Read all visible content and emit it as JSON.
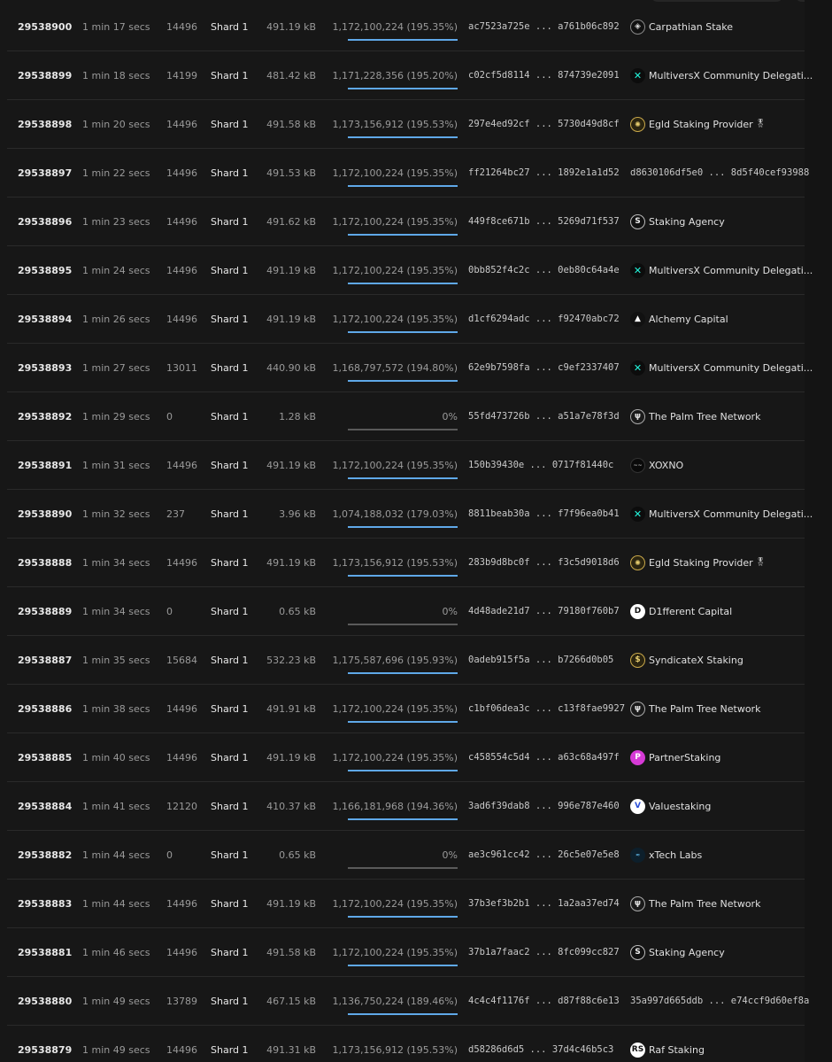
{
  "blocks": [
    {
      "block": "29538900",
      "age": "1 min 17 secs",
      "txs": "14496",
      "shard": "Shard 1",
      "size": "491.19 kB",
      "gas": "1,172,100,224 (195.35%)",
      "gas_pct": 100,
      "hash_start": "ac7523a725e",
      "hash_end": "a761b06c892",
      "validator": "Carpathian Stake",
      "validator_icon": "carpathian-icon",
      "icon_class": "ic-carpathian",
      "badge": ""
    },
    {
      "block": "29538899",
      "age": "1 min 18 secs",
      "txs": "14199",
      "shard": "Shard 1",
      "size": "481.42 kB",
      "gas": "1,171,228,356 (195.20%)",
      "gas_pct": 100,
      "hash_start": "c02cf5d8114",
      "hash_end": "874739e2091",
      "validator": "MultiversX Community Delegati...",
      "validator_icon": "multiversx-icon",
      "icon_class": "ic-mvx",
      "badge": ""
    },
    {
      "block": "29538898",
      "age": "1 min 20 secs",
      "txs": "14496",
      "shard": "Shard 1",
      "size": "491.58 kB",
      "gas": "1,173,156,912 (195.53%)",
      "gas_pct": 100,
      "hash_start": "297e4ed92cf",
      "hash_end": "5730d49d8cf",
      "validator": "Egld Staking Provider",
      "validator_icon": "egld-staking-icon",
      "icon_class": "ic-egld",
      "badge": "🎖"
    },
    {
      "block": "29538897",
      "age": "1 min 22 secs",
      "txs": "14496",
      "shard": "Shard 1",
      "size": "491.53 kB",
      "gas": "1,172,100,224 (195.35%)",
      "gas_pct": 100,
      "hash_start": "ff21264bc27",
      "hash_end": "1892e1a1d52",
      "validator": "d8630106df5e0 ... 8d5f40cef93988",
      "validator_icon": "",
      "icon_class": "",
      "badge": "",
      "plain": true
    },
    {
      "block": "29538896",
      "age": "1 min 23 secs",
      "txs": "14496",
      "shard": "Shard 1",
      "size": "491.62 kB",
      "gas": "1,172,100,224 (195.35%)",
      "gas_pct": 100,
      "hash_start": "449f8ce671b",
      "hash_end": "5269d71f537",
      "validator": "Staking Agency",
      "validator_icon": "staking-agency-icon",
      "icon_class": "ic-staking-agency",
      "badge": ""
    },
    {
      "block": "29538895",
      "age": "1 min 24 secs",
      "txs": "14496",
      "shard": "Shard 1",
      "size": "491.19 kB",
      "gas": "1,172,100,224 (195.35%)",
      "gas_pct": 100,
      "hash_start": "0bb852f4c2c",
      "hash_end": "0eb80c64a4e",
      "validator": "MultiversX Community Delegati...",
      "validator_icon": "multiversx-icon",
      "icon_class": "ic-mvx",
      "badge": ""
    },
    {
      "block": "29538894",
      "age": "1 min 26 secs",
      "txs": "14496",
      "shard": "Shard 1",
      "size": "491.19 kB",
      "gas": "1,172,100,224 (195.35%)",
      "gas_pct": 100,
      "hash_start": "d1cf6294adc",
      "hash_end": "f92470abc72",
      "validator": "Alchemy Capital",
      "validator_icon": "alchemy-icon",
      "icon_class": "ic-alchemy",
      "badge": ""
    },
    {
      "block": "29538893",
      "age": "1 min 27 secs",
      "txs": "13011",
      "shard": "Shard 1",
      "size": "440.90 kB",
      "gas": "1,168,797,572 (194.80%)",
      "gas_pct": 100,
      "hash_start": "62e9b7598fa",
      "hash_end": "c9ef2337407",
      "validator": "MultiversX Community Delegati...",
      "validator_icon": "multiversx-icon",
      "icon_class": "ic-mvx",
      "badge": ""
    },
    {
      "block": "29538892",
      "age": "1 min 29 secs",
      "txs": "0",
      "shard": "Shard 1",
      "size": "1.28 kB",
      "gas": "0%",
      "gas_pct": 0,
      "hash_start": "55fd473726b",
      "hash_end": "a51a7e78f3d",
      "validator": "The Palm Tree Network",
      "validator_icon": "palm-tree-icon",
      "icon_class": "ic-palm",
      "badge": ""
    },
    {
      "block": "29538891",
      "age": "1 min 31 secs",
      "txs": "14496",
      "shard": "Shard 1",
      "size": "491.19 kB",
      "gas": "1,172,100,224 (195.35%)",
      "gas_pct": 100,
      "hash_start": "150b39430e",
      "hash_end": "0717f81440c",
      "validator": "XOXNO",
      "validator_icon": "xoxno-icon",
      "icon_class": "ic-xoxno",
      "badge": ""
    },
    {
      "block": "29538890",
      "age": "1 min 32 secs",
      "txs": "237",
      "shard": "Shard 1",
      "size": "3.96 kB",
      "gas": "1,074,188,032 (179.03%)",
      "gas_pct": 100,
      "hash_start": "8811beab30a",
      "hash_end": "f7f96ea0b41",
      "validator": "MultiversX Community Delegati...",
      "validator_icon": "multiversx-icon",
      "icon_class": "ic-mvx",
      "badge": ""
    },
    {
      "block": "29538888",
      "age": "1 min 34 secs",
      "txs": "14496",
      "shard": "Shard 1",
      "size": "491.19 kB",
      "gas": "1,173,156,912 (195.53%)",
      "gas_pct": 100,
      "hash_start": "283b9d8bc0f",
      "hash_end": "f3c5d9018d6",
      "validator": "Egld Staking Provider",
      "validator_icon": "egld-staking-icon",
      "icon_class": "ic-egld",
      "badge": "🎖"
    },
    {
      "block": "29538889",
      "age": "1 min 34 secs",
      "txs": "0",
      "shard": "Shard 1",
      "size": "0.65 kB",
      "gas": "0%",
      "gas_pct": 0,
      "hash_start": "4d48ade21d7",
      "hash_end": "79180f760b7",
      "validator": "D1fferent Capital",
      "validator_icon": "d1fferent-icon",
      "icon_class": "ic-d1fferent",
      "badge": ""
    },
    {
      "block": "29538887",
      "age": "1 min 35 secs",
      "txs": "15684",
      "shard": "Shard 1",
      "size": "532.23 kB",
      "gas": "1,175,587,696 (195.93%)",
      "gas_pct": 100,
      "hash_start": "0adeb915f5a",
      "hash_end": "b7266d0b05",
      "validator": "SyndicateX Staking",
      "validator_icon": "syndicatex-icon",
      "icon_class": "ic-syndicate",
      "badge": ""
    },
    {
      "block": "29538886",
      "age": "1 min 38 secs",
      "txs": "14496",
      "shard": "Shard 1",
      "size": "491.91 kB",
      "gas": "1,172,100,224 (195.35%)",
      "gas_pct": 100,
      "hash_start": "c1bf06dea3c",
      "hash_end": "c13f8fae9927",
      "validator": "The Palm Tree Network",
      "validator_icon": "palm-tree-icon",
      "icon_class": "ic-palm",
      "badge": ""
    },
    {
      "block": "29538885",
      "age": "1 min 40 secs",
      "txs": "14496",
      "shard": "Shard 1",
      "size": "491.19 kB",
      "gas": "1,172,100,224 (195.35%)",
      "gas_pct": 100,
      "hash_start": "c458554c5d4",
      "hash_end": "a63c68a497f",
      "validator": "PartnerStaking",
      "validator_icon": "partnerstaking-icon",
      "icon_class": "ic-partner",
      "badge": ""
    },
    {
      "block": "29538884",
      "age": "1 min 41 secs",
      "txs": "12120",
      "shard": "Shard 1",
      "size": "410.37 kB",
      "gas": "1,166,181,968 (194.36%)",
      "gas_pct": 100,
      "hash_start": "3ad6f39dab8",
      "hash_end": "996e787e460",
      "validator": "Valuestaking",
      "validator_icon": "valuestaking-icon",
      "icon_class": "ic-value",
      "badge": ""
    },
    {
      "block": "29538882",
      "age": "1 min 44 secs",
      "txs": "0",
      "shard": "Shard 1",
      "size": "0.65 kB",
      "gas": "0%",
      "gas_pct": 0,
      "hash_start": "ae3c961cc42",
      "hash_end": "26c5e07e5e8",
      "validator": "xTech Labs",
      "validator_icon": "xtech-icon",
      "icon_class": "ic-xtech",
      "badge": ""
    },
    {
      "block": "29538883",
      "age": "1 min 44 secs",
      "txs": "14496",
      "shard": "Shard 1",
      "size": "491.19 kB",
      "gas": "1,172,100,224 (195.35%)",
      "gas_pct": 100,
      "hash_start": "37b3ef3b2b1",
      "hash_end": "1a2aa37ed74",
      "validator": "The Palm Tree Network",
      "validator_icon": "palm-tree-icon",
      "icon_class": "ic-palm",
      "badge": ""
    },
    {
      "block": "29538881",
      "age": "1 min 46 secs",
      "txs": "14496",
      "shard": "Shard 1",
      "size": "491.58 kB",
      "gas": "1,172,100,224 (195.35%)",
      "gas_pct": 100,
      "hash_start": "37b1a7faac2",
      "hash_end": "8fc099cc827",
      "validator": "Staking Agency",
      "validator_icon": "staking-agency-icon",
      "icon_class": "ic-staking-agency",
      "badge": ""
    },
    {
      "block": "29538880",
      "age": "1 min 49 secs",
      "txs": "13789",
      "shard": "Shard 1",
      "size": "467.15 kB",
      "gas": "1,136,750,224 (189.46%)",
      "gas_pct": 100,
      "hash_start": "4c4c4f1176f",
      "hash_end": "d87f88c6e13",
      "validator": "35a997d665ddb ... e74ccf9d60ef8a",
      "validator_icon": "",
      "icon_class": "",
      "badge": "",
      "plain": true
    },
    {
      "block": "29538879",
      "age": "1 min 49 secs",
      "txs": "14496",
      "shard": "Shard 1",
      "size": "491.31 kB",
      "gas": "1,173,156,912 (195.53%)",
      "gas_pct": 100,
      "hash_start": "d58286d6d5",
      "hash_end": "37d4c46b5c3",
      "validator": "Raf Staking",
      "validator_icon": "raf-staking-icon",
      "icon_class": "ic-raf",
      "badge": ""
    }
  ],
  "icon_glyphs": {
    "carpathian-icon": "◈",
    "multiversx-icon": "✕",
    "egld-staking-icon": "✺",
    "staking-agency-icon": "S",
    "alchemy-icon": "▲",
    "palm-tree-icon": "ψ",
    "xoxno-icon": "~~",
    "d1fferent-icon": "D",
    "syndicatex-icon": "$",
    "partnerstaking-icon": "P",
    "valuestaking-icon": "V",
    "xtech-icon": "≈",
    "raf-staking-icon": "RS"
  },
  "colors": {
    "background": "#171717",
    "gas_bar_fill": "#5fa8e8",
    "gas_bar_empty": "#5a5a5a",
    "row_divider": "#2a2a2a"
  }
}
